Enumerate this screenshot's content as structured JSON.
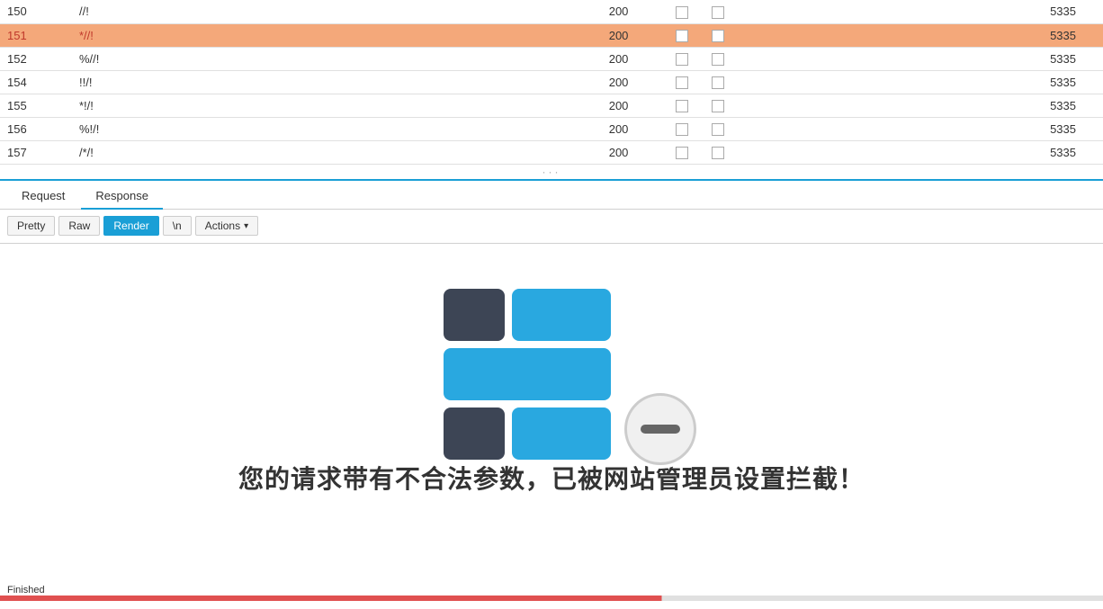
{
  "table": {
    "rows": [
      {
        "id": "150",
        "path": "//!",
        "code": "200",
        "col4": "",
        "col5": "",
        "size": "5335",
        "highlighted": false
      },
      {
        "id": "151",
        "path": "*//!",
        "code": "200",
        "col4": "",
        "col5": "",
        "size": "5335",
        "highlighted": true
      },
      {
        "id": "152",
        "path": "%//!",
        "code": "200",
        "col4": "",
        "col5": "",
        "size": "5335",
        "highlighted": false
      },
      {
        "id": "154",
        "path": "!!/!",
        "code": "200",
        "col4": "",
        "col5": "",
        "size": "5335",
        "highlighted": false
      },
      {
        "id": "155",
        "path": "*!/!",
        "code": "200",
        "col4": "",
        "col5": "",
        "size": "5335",
        "highlighted": false
      },
      {
        "id": "156",
        "path": "%!/!",
        "code": "200",
        "col4": "",
        "col5": "",
        "size": "5335",
        "highlighted": false
      },
      {
        "id": "157",
        "path": "/*/!",
        "code": "200",
        "col4": "",
        "col5": "",
        "size": "5335",
        "highlighted": false
      }
    ]
  },
  "tabs": {
    "request_label": "Request",
    "response_label": "Response",
    "active": "Response"
  },
  "toolbar": {
    "pretty_label": "Pretty",
    "raw_label": "Raw",
    "render_label": "Render",
    "n_label": "\\n",
    "actions_label": "Actions"
  },
  "render": {
    "blocked_text": "您的请求带有不合法参数，已被网站管理员设置拦截！"
  },
  "status": {
    "text": "Finished",
    "color": "#e05050"
  }
}
